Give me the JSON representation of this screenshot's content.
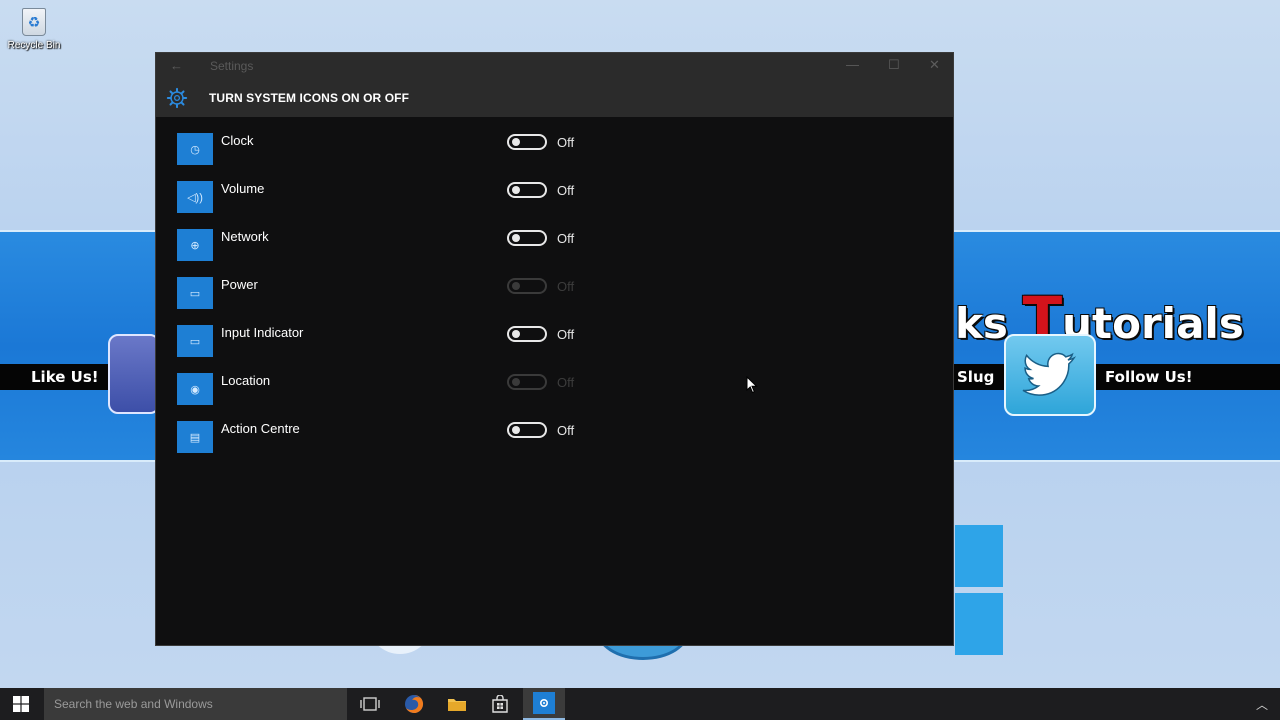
{
  "desktop": {
    "recycle_bin_label": "Recycle Bin",
    "banner_left_text": "Like Us!",
    "banner_right_text": "Follow Us!",
    "banner_mid_text": "Slug",
    "banner_title_prefix": "ks ",
    "banner_title_red": "T",
    "banner_title_suffix": "utorials"
  },
  "window": {
    "title": "Settings",
    "page_heading": "TURN SYSTEM ICONS ON OR OFF",
    "items": [
      {
        "label": "Clock",
        "state": "Off",
        "enabled": true,
        "icon": "clock-icon"
      },
      {
        "label": "Volume",
        "state": "Off",
        "enabled": true,
        "icon": "volume-icon"
      },
      {
        "label": "Network",
        "state": "Off",
        "enabled": true,
        "icon": "network-icon"
      },
      {
        "label": "Power",
        "state": "Off",
        "enabled": false,
        "icon": "battery-icon"
      },
      {
        "label": "Input Indicator",
        "state": "Off",
        "enabled": true,
        "icon": "keyboard-icon"
      },
      {
        "label": "Location",
        "state": "Off",
        "enabled": false,
        "icon": "location-icon"
      },
      {
        "label": "Action Centre",
        "state": "Off",
        "enabled": true,
        "icon": "action-centre-icon"
      }
    ]
  },
  "taskbar": {
    "search_placeholder": "Search the web and Windows"
  },
  "colors": {
    "accent": "#1e7fd4",
    "window_bg": "#0f0f10",
    "header_bg": "#2b2b2b",
    "taskbar_bg": "#1d1d1f"
  }
}
